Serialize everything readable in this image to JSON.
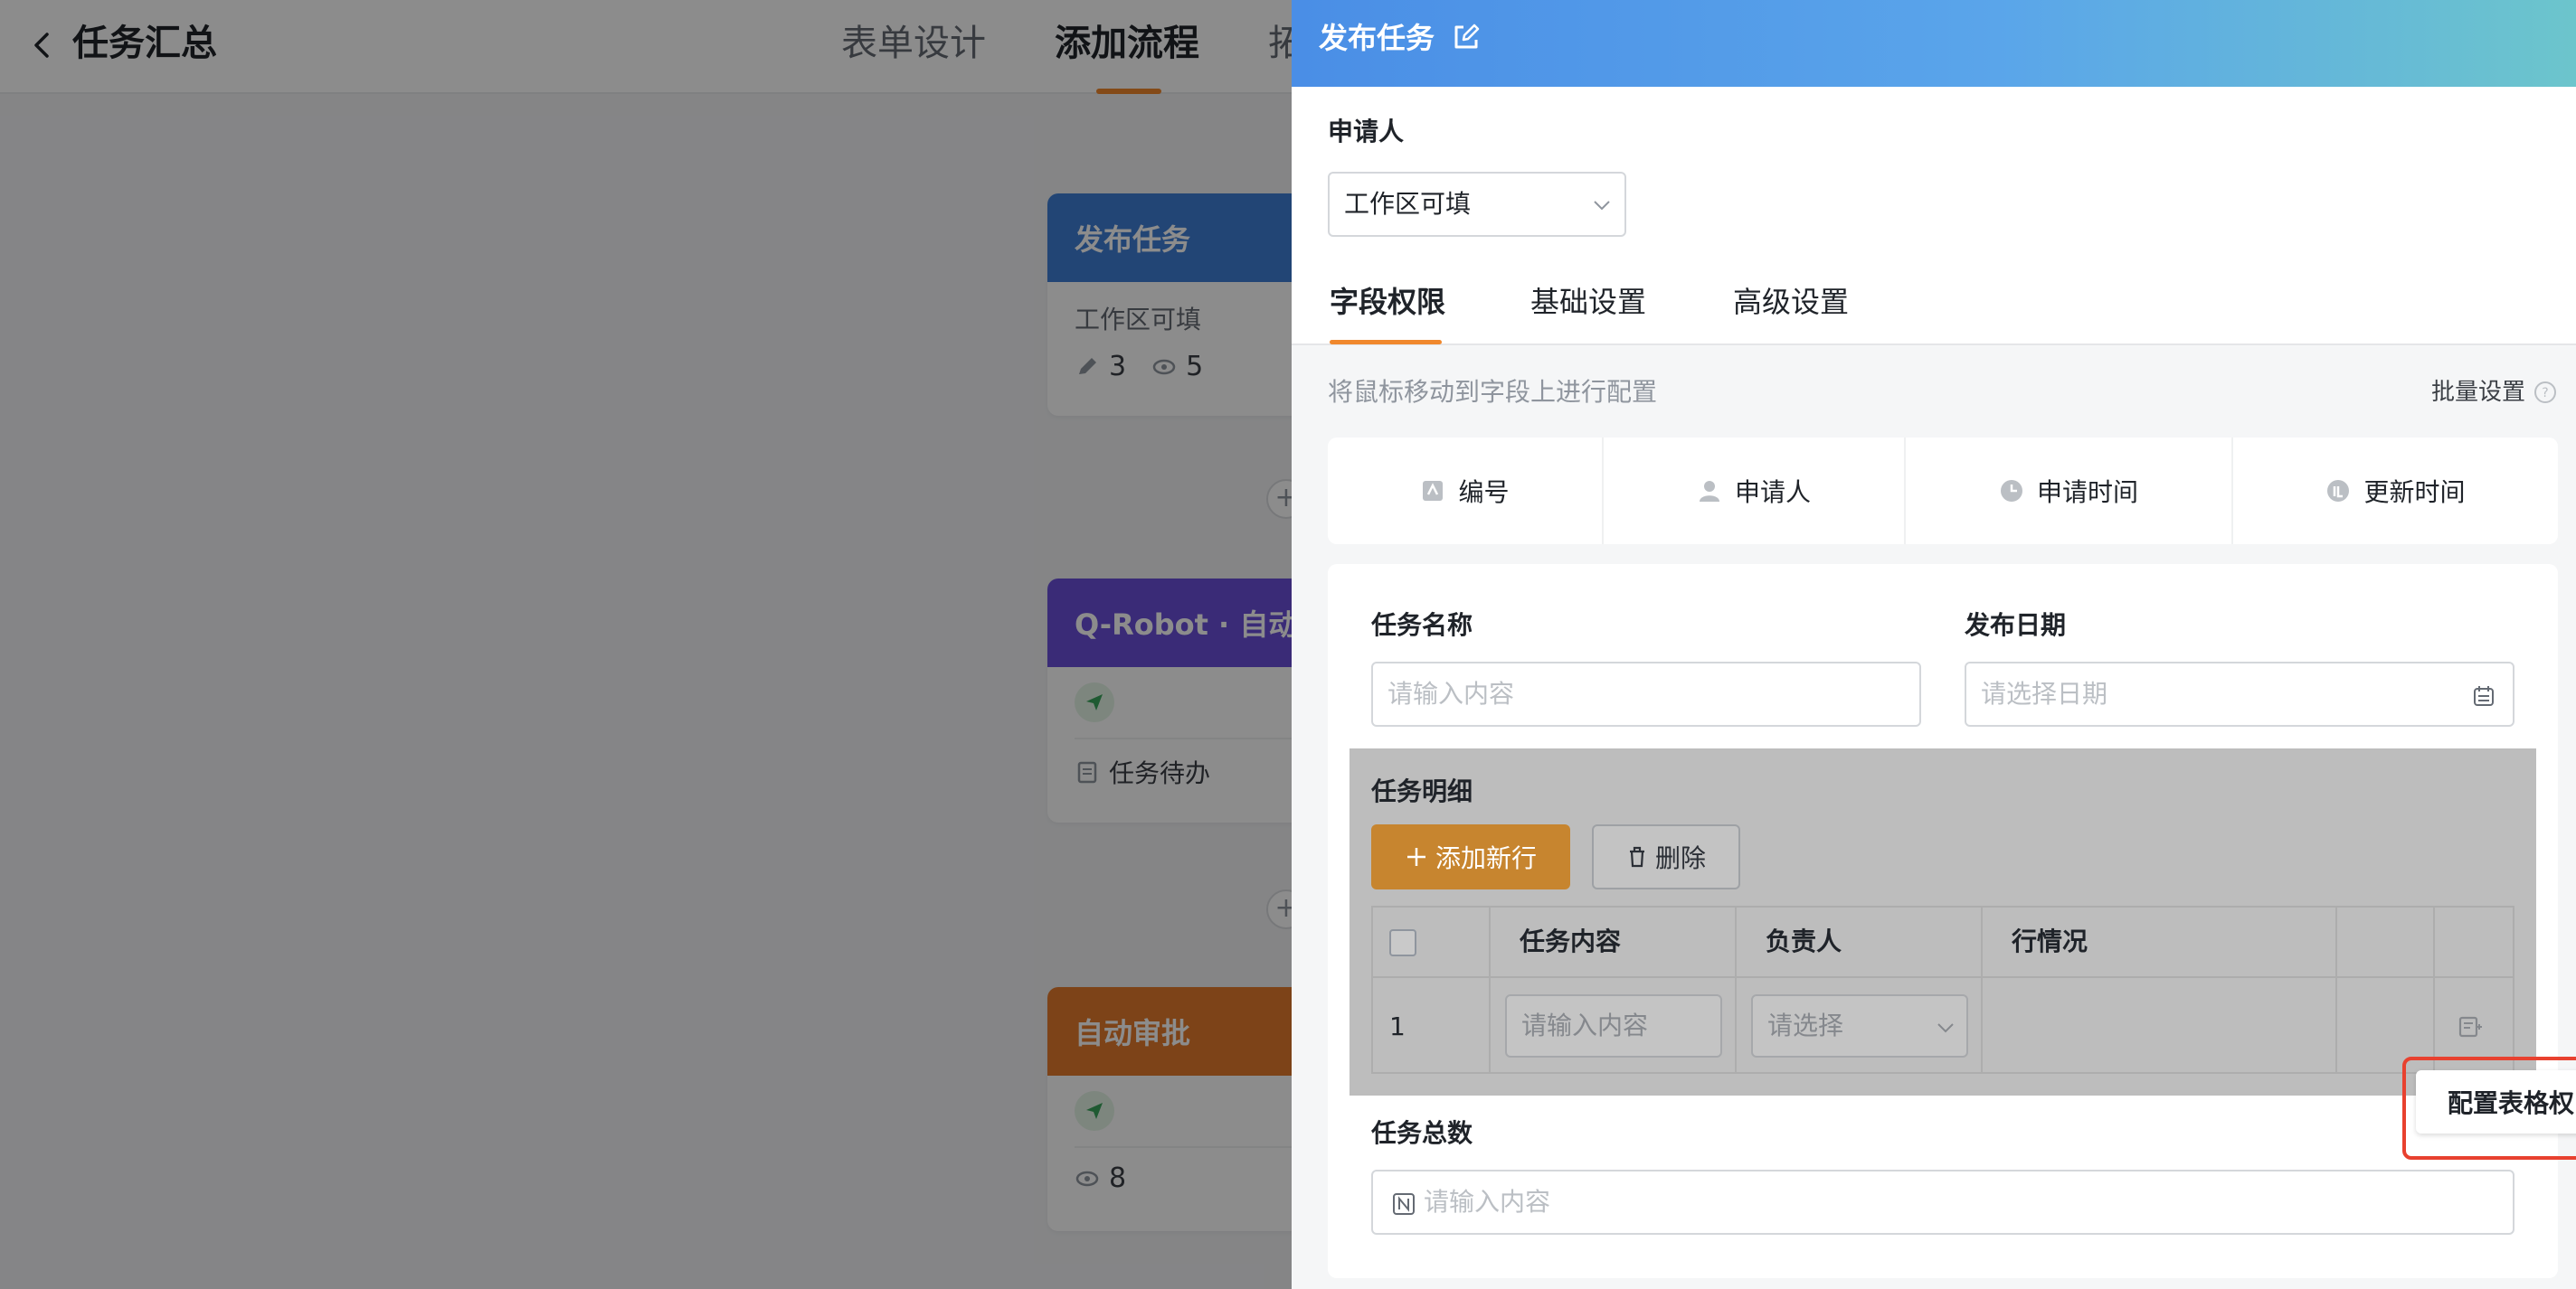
{
  "background": {
    "header": {
      "title": "任务汇总",
      "tabs": [
        {
          "label": "表单设计",
          "active": false
        },
        {
          "label": "添加流程",
          "active": true
        },
        {
          "label": "拓",
          "active": false
        }
      ]
    },
    "cards": [
      {
        "title": "发布任务",
        "color": "#3f7fd6",
        "subtitle": "工作区可填",
        "edit_count": "3",
        "view_count": "5"
      },
      {
        "title": "Q-Robot · 自动",
        "color": "#6a4fd9",
        "row_text": "任务待办"
      },
      {
        "title": "自动审批",
        "color": "#e37b2c",
        "view_count": "8"
      }
    ]
  },
  "drawer": {
    "title": "发布任务",
    "applicant": {
      "label": "申请人",
      "value": "工作区可填"
    },
    "tabs": [
      {
        "label": "字段权限",
        "active": true
      },
      {
        "label": "基础设置",
        "active": false
      },
      {
        "label": "高级设置",
        "active": false
      }
    ],
    "hint": "将鼠标移动到字段上进行配置",
    "batch_label": "批量设置",
    "system_fields": [
      {
        "label": "编号",
        "icon": "id-icon"
      },
      {
        "label": "申请人",
        "icon": "person-icon"
      },
      {
        "label": "申请时间",
        "icon": "clock-icon"
      },
      {
        "label": "更新时间",
        "icon": "update-time-icon"
      }
    ],
    "form": {
      "task_name": {
        "label": "任务名称",
        "placeholder": "请输入内容"
      },
      "publish_date": {
        "label": "发布日期",
        "placeholder": "请选择日期"
      },
      "details": {
        "label": "任务明细",
        "add_row": "添加新行",
        "delete": "删除",
        "columns": [
          "任务内容",
          "负责人",
          "执行情况"
        ],
        "visible_column_fragments": {
          "owner": "负责人",
          "status": "行情况"
        },
        "rows": [
          {
            "num": "1",
            "content_placeholder": "请输入内容",
            "owner_placeholder": "请选择"
          }
        ],
        "config_button": "配置表格权限"
      },
      "task_total": {
        "label": "任务总数",
        "placeholder": "请输入内容"
      }
    },
    "colors": {
      "accent": "#f0882d",
      "highlight": "#e8412f",
      "header_start": "#4a8ee6",
      "header_end": "#6cc5cc"
    }
  }
}
